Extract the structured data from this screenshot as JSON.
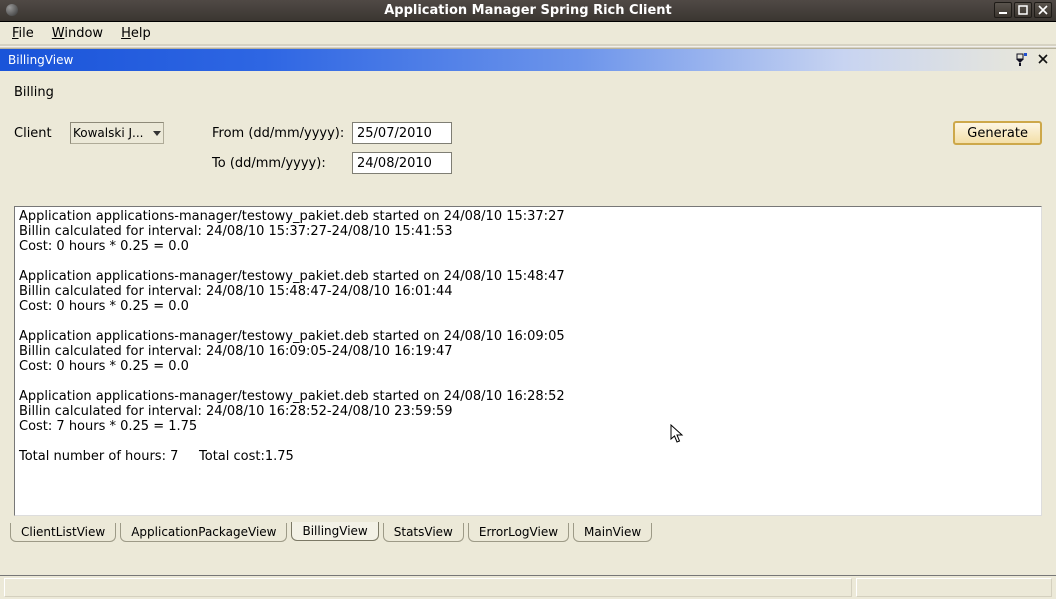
{
  "window": {
    "title": "Application Manager Spring Rich Client"
  },
  "menu": {
    "file": "File",
    "window": "Window",
    "help": "Help"
  },
  "panel": {
    "title": "BillingView"
  },
  "billing": {
    "section_title": "Billing",
    "client_label": "Client",
    "client_value": "Kowalski J...",
    "from_label": "From (dd/mm/yyyy):",
    "from_value": "25/07/2010",
    "to_label": "To (dd/mm/yyyy):",
    "to_value": "24/08/2010",
    "generate_label": "Generate"
  },
  "output_text": "Application applications-manager/testowy_pakiet.deb started on 24/08/10 15:37:27\nBillin calculated for interval: 24/08/10 15:37:27-24/08/10 15:41:53\nCost: 0 hours * 0.25 = 0.0\n\nApplication applications-manager/testowy_pakiet.deb started on 24/08/10 15:48:47\nBillin calculated for interval: 24/08/10 15:48:47-24/08/10 16:01:44\nCost: 0 hours * 0.25 = 0.0\n\nApplication applications-manager/testowy_pakiet.deb started on 24/08/10 16:09:05\nBillin calculated for interval: 24/08/10 16:09:05-24/08/10 16:19:47\nCost: 0 hours * 0.25 = 0.0\n\nApplication applications-manager/testowy_pakiet.deb started on 24/08/10 16:28:52\nBillin calculated for interval: 24/08/10 16:28:52-24/08/10 23:59:59\nCost: 7 hours * 0.25 = 1.75\n\nTotal number of hours: 7     Total cost:1.75",
  "tabs": {
    "client_list": "ClientListView",
    "app_package": "ApplicationPackageView",
    "billing": "BillingView",
    "stats": "StatsView",
    "error_log": "ErrorLogView",
    "main": "MainView"
  }
}
